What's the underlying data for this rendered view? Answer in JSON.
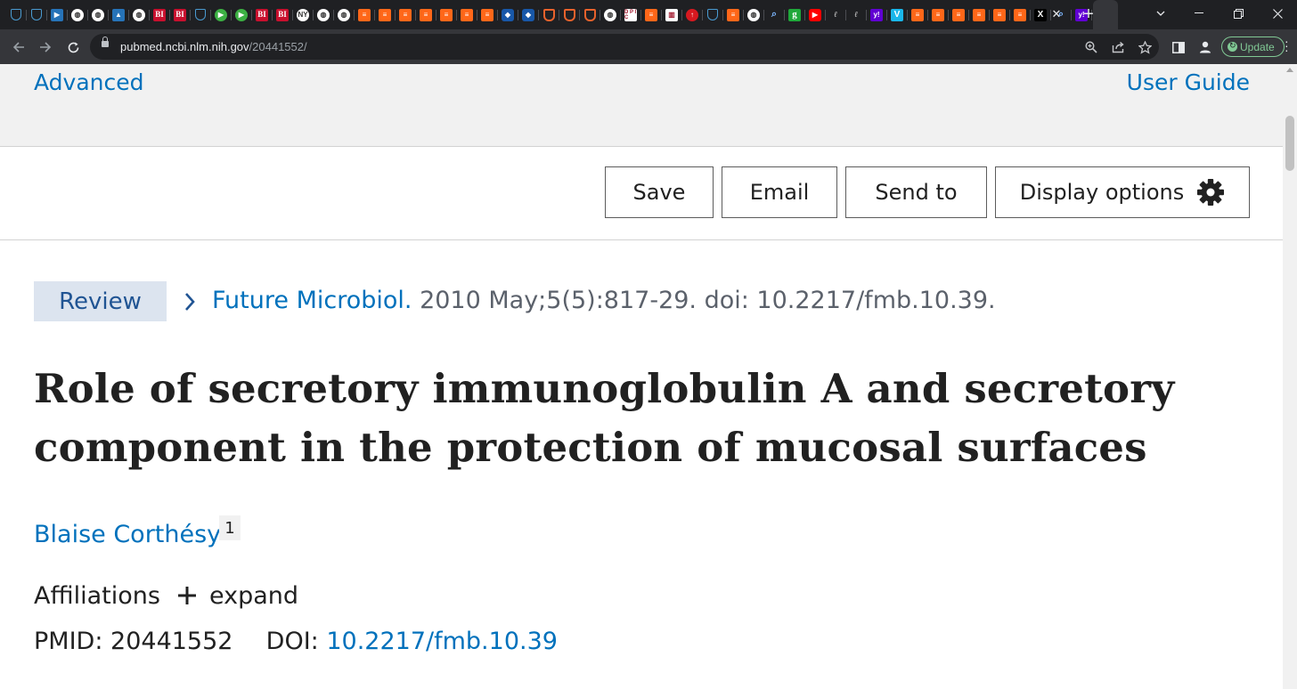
{
  "browser": {
    "tab_icons": [
      "shield-icon",
      "shield-icon",
      "bookmark-icon",
      "globe-icon",
      "globe-icon",
      "graduation-cap-icon",
      "globe-icon",
      "bi-icon",
      "bi-icon",
      "shield-icon",
      "play-icon",
      "play-icon",
      "bi-icon",
      "bi-icon",
      "news-icon",
      "globe-icon",
      "globe-icon",
      "substack-icon",
      "substack-icon",
      "substack-icon",
      "substack-icon",
      "substack-icon",
      "substack-icon",
      "substack-icon",
      "cube-icon",
      "cube-icon",
      "ublock-icon",
      "ublock-icon",
      "ublock-icon",
      "globe-icon",
      "dpic-icon",
      "substack-icon",
      "bar-icon",
      "red-pin-icon",
      "shield-icon",
      "substack-icon",
      "globe-icon",
      "search-icon",
      "g-icon",
      "youtube-icon",
      "script-icon",
      "script-icon",
      "yahoo-icon",
      "vimeo-icon",
      "substack-icon",
      "substack-icon",
      "substack-icon",
      "substack-icon",
      "substack-icon",
      "substack-icon",
      "x-icon",
      "search-icon",
      "yahoo-icon"
    ],
    "tab_labels": {
      "bi": "BI",
      "g": "g",
      "yahoo": "y!",
      "vimeo": "V",
      "x": "X",
      "dpic": "D P I C",
      "news": "NY"
    },
    "active_tab_close": "✕",
    "new_tab": "+",
    "url_host": "pubmed.ncbi.nlm.nih.gov",
    "url_path": "/20441552/",
    "update_label": "Update",
    "colors": {
      "tabstrip": "#1f2023",
      "toolbar": "#35363a",
      "omnibox": "#202124",
      "update": "#81c995"
    }
  },
  "search": {
    "advanced_label": "Advanced",
    "user_guide_label": "User Guide"
  },
  "actions": {
    "save_label": "Save",
    "email_label": "Email",
    "send_to_label": "Send to",
    "display_options_label": "Display options"
  },
  "article": {
    "publication_type": "Review",
    "journal": "Future Microbiol.",
    "citation_details": " 2010 May;5(5):817-29. doi: 10.2217/fmb.10.39.",
    "title_line_1": "Role of secretory immunoglobulin A and secretory",
    "title_line_2": "component in the protection of mucosal surfaces",
    "author": "Blaise Corthésy",
    "author_affiliation_number": "1",
    "affiliations_label": "Affiliations",
    "expand_label": "expand",
    "pmid_label": "PMID:",
    "pmid": "20441552",
    "doi_label": "DOI:",
    "doi": "10.2217/fmb.10.39"
  },
  "colors": {
    "link": "#0071bc",
    "text": "#212121",
    "muted": "#5b616b",
    "badge_bg": "#dce4ef",
    "band_bg": "#f1f1f1"
  }
}
